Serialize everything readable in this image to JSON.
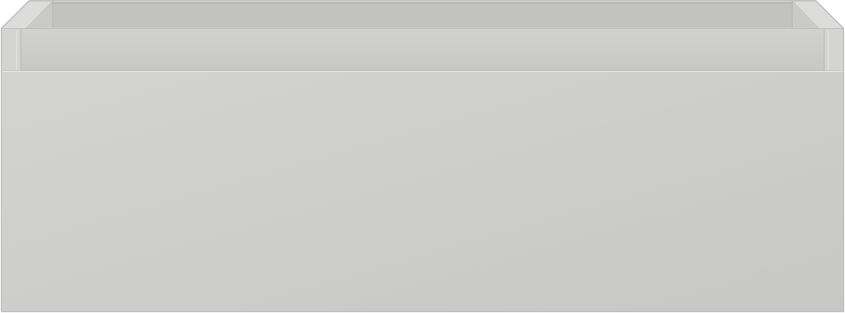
{
  "object": {
    "name": "drawer-box",
    "colors": {
      "background": "#ffffff",
      "back_wall": "#c2c2c0",
      "back_wall_shadow": "#b9b9b7",
      "inner_side": "#c9c9c7",
      "top_rail": "#d2d2d0",
      "rim": "#dcdcda",
      "side_post": "#d4d4d2",
      "front_panel_light": "#d3d3d1",
      "front_panel_dark": "#c7c7c5",
      "edge_line": "#b4b4b2",
      "highlight": "#ebebea"
    }
  }
}
